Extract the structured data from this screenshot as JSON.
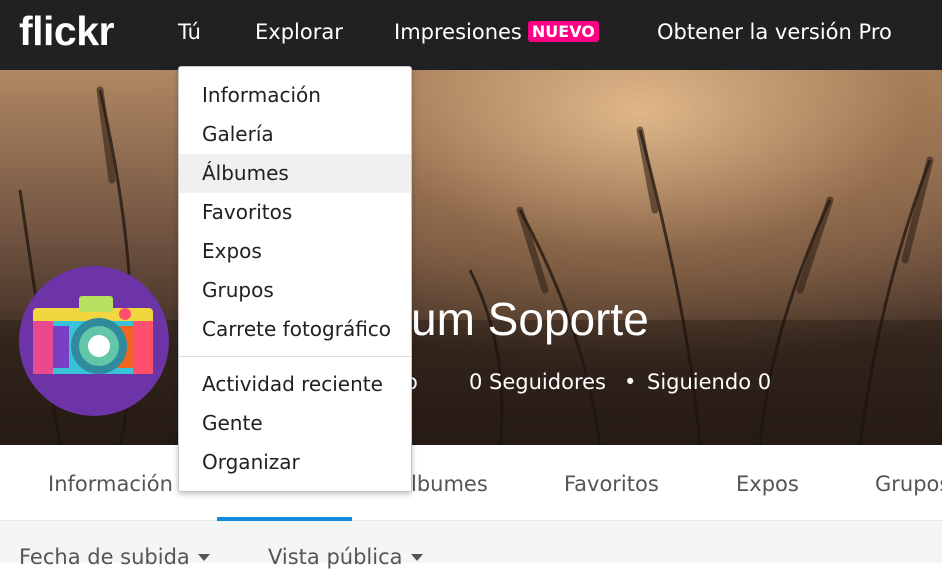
{
  "brand": {
    "logo": "flickr"
  },
  "nav": {
    "you": "Tú",
    "explore": "Explorar",
    "prints": "Impresiones",
    "prints_badge": "NUEVO",
    "pro": "Obtener la versión Pro"
  },
  "colors": {
    "topbar": "#212124",
    "badge": "#ff0084",
    "active_tab": "#128fdc"
  },
  "dropdown": {
    "items": [
      "Información",
      "Galería",
      "Álbumes",
      "Favoritos",
      "Expos",
      "Grupos",
      "Carrete fotográfico"
    ],
    "items2": [
      "Actividad reciente",
      "Gente",
      "Organizar"
    ],
    "highlighted": "Álbumes"
  },
  "profile": {
    "name_visible": "um Soporte",
    "stat_partial": "o",
    "followers": "0 Seguidores",
    "separator": "•",
    "following": "Siguiendo 0"
  },
  "subnav": {
    "tabs": [
      "Información",
      "lbumes",
      "Favoritos",
      "Expos",
      "Grupos"
    ],
    "active": "Álbumes"
  },
  "filters": {
    "upload_date": "Fecha de subida",
    "public_view": "Vista pública"
  }
}
